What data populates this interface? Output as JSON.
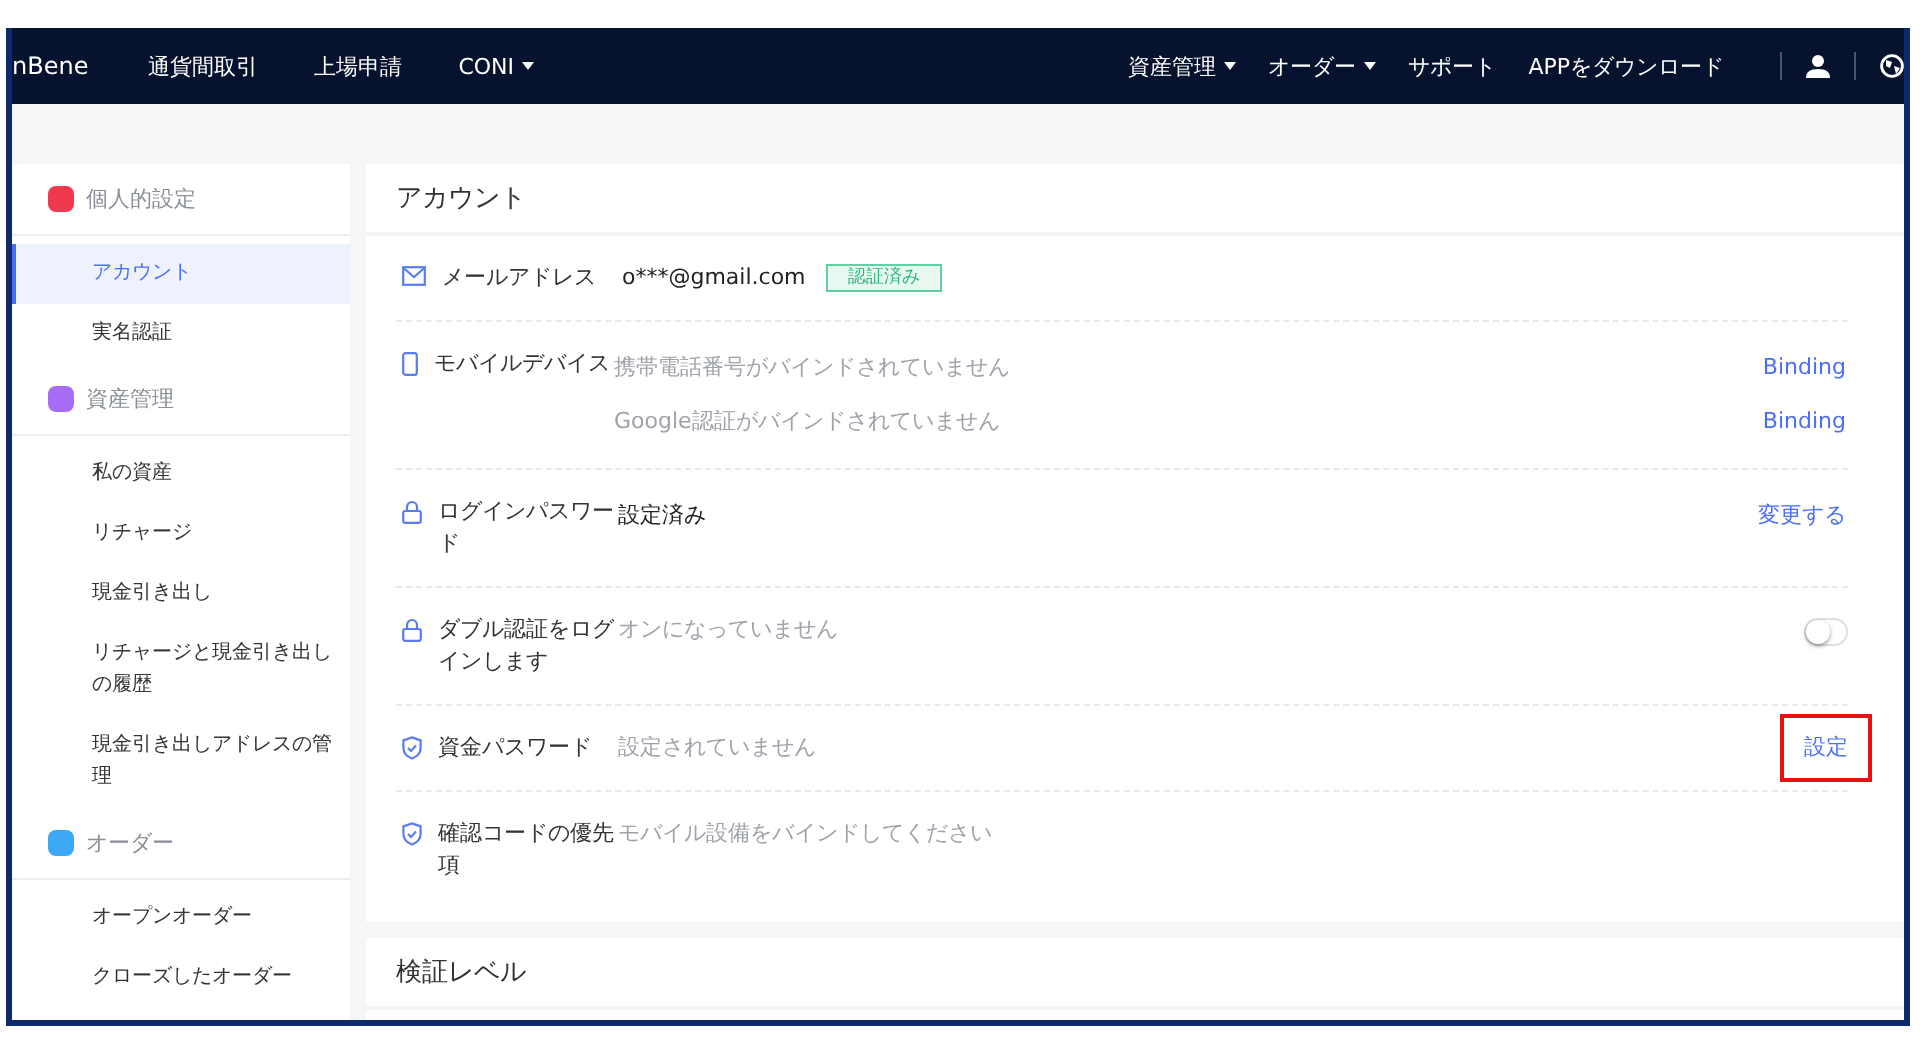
{
  "nav": {
    "logo": "nBene",
    "left": [
      {
        "label": "通貨間取引",
        "dropdown": false
      },
      {
        "label": "上場申請",
        "dropdown": false
      },
      {
        "label": "CONI",
        "dropdown": true
      }
    ],
    "right": [
      {
        "label": "資産管理",
        "dropdown": true
      },
      {
        "label": "オーダー",
        "dropdown": true
      },
      {
        "label": "サポート",
        "dropdown": false
      },
      {
        "label": "APPをダウンロード",
        "dropdown": false
      }
    ]
  },
  "sidebar": {
    "groups": [
      {
        "title": "個人的設定",
        "color": "#f0384f",
        "items": [
          {
            "label": "アカウント",
            "selected": true
          },
          {
            "label": "実名認証",
            "selected": false
          }
        ]
      },
      {
        "title": "資産管理",
        "color": "#a66cf5",
        "items": [
          {
            "label": "私の資産",
            "selected": false
          },
          {
            "label": "リチャージ",
            "selected": false
          },
          {
            "label": "現金引き出し",
            "selected": false
          },
          {
            "label": "リチャージと現金引き出しの履歴",
            "selected": false
          },
          {
            "label": "現金引き出しアドレスの管理",
            "selected": false
          }
        ]
      },
      {
        "title": "オーダー",
        "color": "#3ba7f5",
        "items": [
          {
            "label": "オープンオーダー",
            "selected": false
          },
          {
            "label": "クローズしたオーダー",
            "selected": false
          }
        ]
      }
    ]
  },
  "account": {
    "title": "アカウント",
    "rows": [
      {
        "kind": "mail",
        "label": "メールアドレス",
        "badge": "認証済み",
        "lines": [
          {
            "text": "o***@gmail.com",
            "muted": false
          }
        ]
      },
      {
        "kind": "phone",
        "label": "モバイルデバイス",
        "lines": [
          {
            "text": "携帯電話番号がバインドされていません",
            "muted": true,
            "action": "Binding",
            "highlighted": false
          },
          {
            "text": "Google認証がバインドされていません",
            "muted": true,
            "action": "Binding",
            "highlighted": false
          }
        ]
      },
      {
        "kind": "lock",
        "label": "ログインパスワード",
        "lines": [
          {
            "text": "設定済み",
            "muted": false,
            "action": "変更する",
            "highlighted": false
          }
        ]
      },
      {
        "kind": "lock",
        "label": "ダブル認証をログインします",
        "lines": [
          {
            "text": "オンになっていません",
            "muted": true
          }
        ],
        "toggle": {
          "on": false
        }
      },
      {
        "kind": "shield",
        "label": "資金パスワード",
        "lines": [
          {
            "text": "設定されていません",
            "muted": true,
            "action": "設定",
            "highlighted": true
          }
        ]
      },
      {
        "kind": "shield",
        "label": "確認コードの優先項",
        "lines": [
          {
            "text": "モバイル設備をバインドしてください",
            "muted": true
          }
        ]
      }
    ]
  },
  "verification": {
    "title": "検証レベル"
  }
}
